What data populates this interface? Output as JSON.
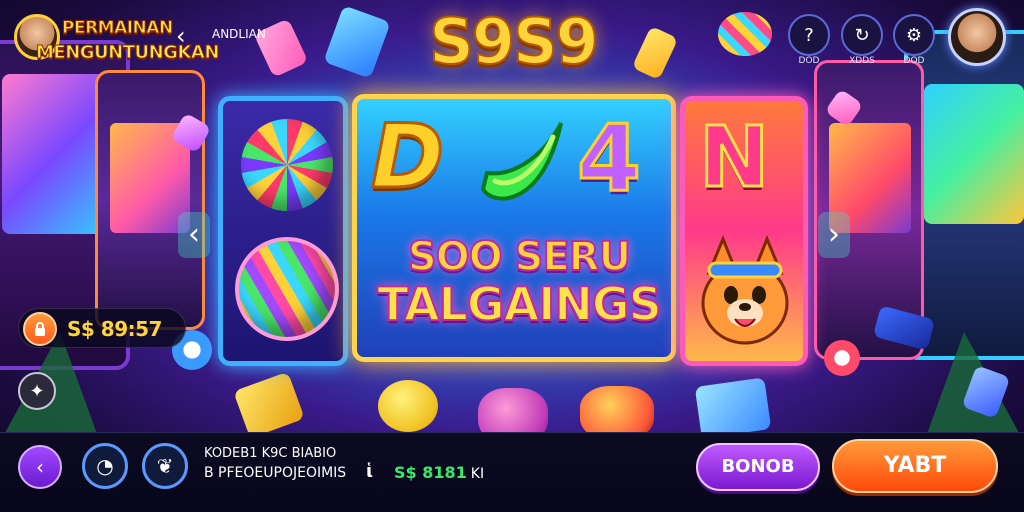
{
  "header": {
    "logo_line1": "PERMAINAN",
    "logo_line2": "MENGUNTUNGKAN",
    "nav_label": "ANDLIAN",
    "game_title": "S9S9",
    "icons": [
      {
        "name": "info-icon",
        "glyph": "?",
        "label": "DOD"
      },
      {
        "name": "refresh-icon",
        "glyph": "↻",
        "label": "XDDS"
      },
      {
        "name": "gear-icon",
        "glyph": "⚙",
        "label": "DOD"
      }
    ]
  },
  "reels": {
    "center_symbols": [
      "D",
      "4"
    ],
    "right_symbol": "N",
    "banner_line1": "SOO SERU",
    "banner_line2": "TALGAINGS"
  },
  "timer": {
    "text": "S$ 89:57"
  },
  "bottom_bar": {
    "line1": "KODEB1 K9C BIABIO",
    "line2": "B PFEOEUPOJEOIMIS",
    "separator": "ἱ",
    "balance": "S$ 8181",
    "balance_unit": "KI",
    "bonus_label": "BONOB",
    "start_label": "YABT"
  },
  "colors": {
    "accent_gold": "#ffd43a",
    "accent_purple": "#a24aff",
    "accent_orange": "#ff5a1a",
    "balance_green": "#3ae86a"
  }
}
